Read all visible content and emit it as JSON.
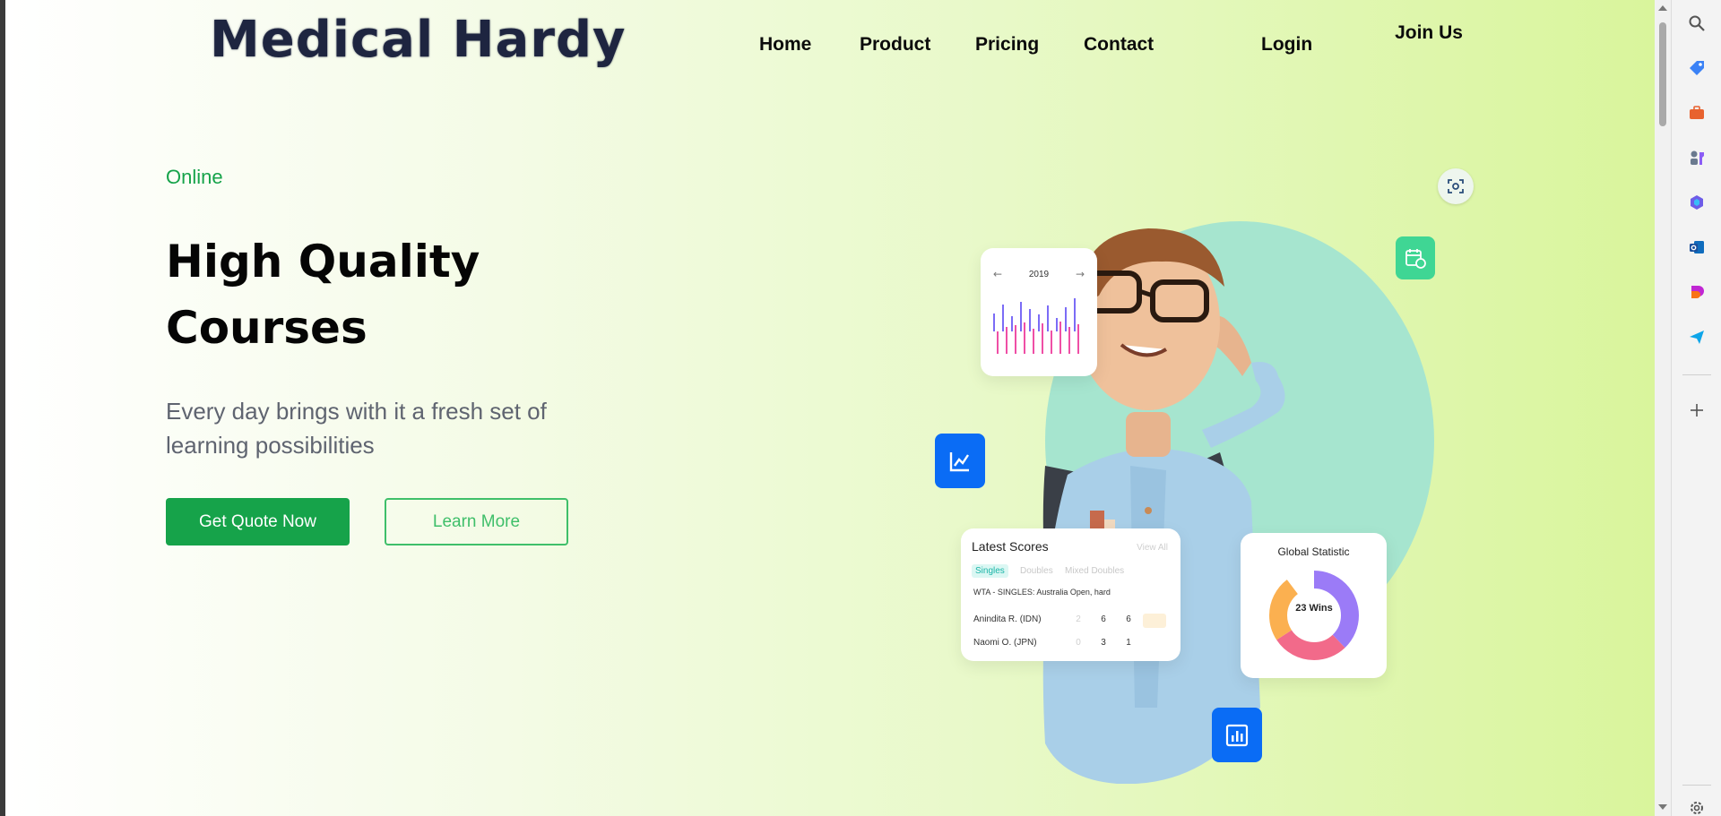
{
  "site": {
    "logo": "Medical Hardy",
    "nav": [
      {
        "label": "Home"
      },
      {
        "label": "Product"
      },
      {
        "label": "Pricing"
      },
      {
        "label": "Contact"
      },
      {
        "label": "Login"
      }
    ],
    "join": "Join Us"
  },
  "hero": {
    "eyebrow": "Online",
    "headline": "High Quality Courses",
    "subtitle": "Every day brings with it a fresh set of learning possibilities",
    "primary_button": "Get Quote Now",
    "secondary_button": "Learn More"
  },
  "illustration": {
    "year_card": {
      "year": "2019",
      "prev": "←",
      "next": "→"
    },
    "scores_card": {
      "title": "Latest Scores",
      "view_all": "View All",
      "tabs": [
        "Singles",
        "Doubles",
        "Mixed Doubles"
      ],
      "event": "WTA - SINGLES: Australia Open, hard",
      "players": [
        {
          "name": "Anindita R. (IDN)",
          "scores": [
            "2",
            "6",
            "6"
          ]
        },
        {
          "name": "Naomi O. (JPN)",
          "scores": [
            "0",
            "3",
            "1"
          ]
        }
      ]
    },
    "stat_card": {
      "title": "Global Statistic",
      "center": "23 Wins"
    }
  },
  "colors": {
    "accent": "#16a34a",
    "blue_tile": "#0a6cf5",
    "green_tile": "#3fd694",
    "blob": "#a6e5cf"
  },
  "sidebar_icons": [
    "search-icon",
    "tag-icon",
    "briefcase-icon",
    "chess-icon",
    "copilot-icon",
    "outlook-icon",
    "designer-icon",
    "send-icon",
    "add-icon",
    "settings-icon"
  ]
}
